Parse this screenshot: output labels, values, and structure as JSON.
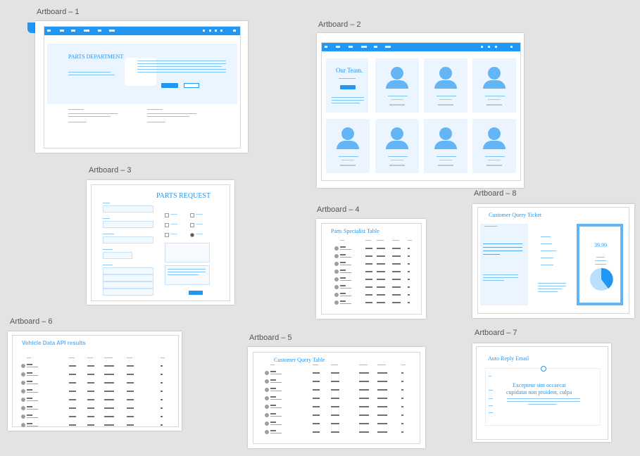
{
  "artboards": {
    "a1": {
      "label": "Artboard – 1",
      "title": "PARTS DEPARTMENT"
    },
    "a2": {
      "label": "Artboard – 2",
      "title": "Our Team."
    },
    "a3": {
      "label": "Artboard – 3",
      "title": "PARTS REQUEST"
    },
    "a4": {
      "label": "Artboard – 4",
      "title": "Parts Specialist Table"
    },
    "a5": {
      "label": "Artboard – 5",
      "title": "Customer Query Table"
    },
    "a6": {
      "label": "Artboard – 6",
      "title": "Vehicle Data API results"
    },
    "a7": {
      "label": "Artboard – 7",
      "title": "Auto Reply Email",
      "headline_1": "Excepteur sint occaecat",
      "headline_2": "cupidatat non proident, culpa"
    },
    "a8": {
      "label": "Artboard – 8",
      "title": "Customer Query Ticket",
      "price": "39.99"
    }
  },
  "colors": {
    "accent": "#2196f3",
    "light": "#eaf5ff",
    "canvas": "#e3e3e3"
  }
}
